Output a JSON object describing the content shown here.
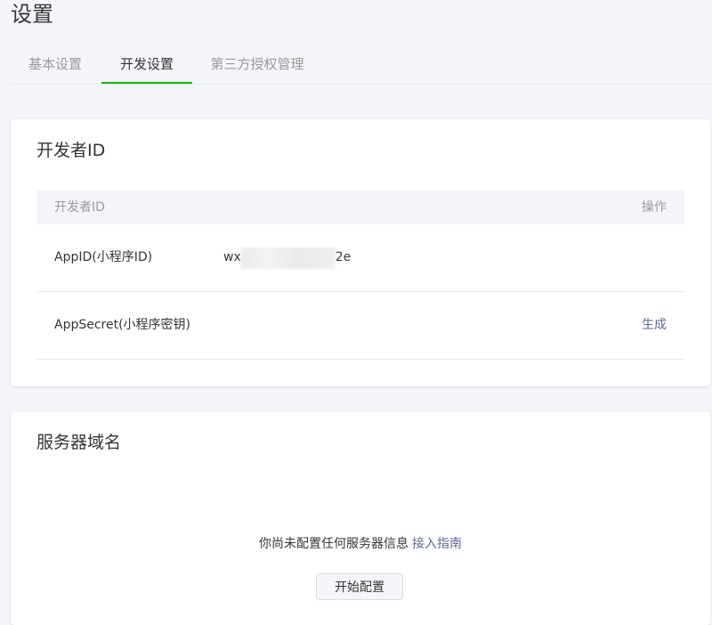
{
  "page": {
    "title": "设置"
  },
  "tabs": [
    {
      "label": "基本设置",
      "active": false
    },
    {
      "label": "开发设置",
      "active": true
    },
    {
      "label": "第三方授权管理",
      "active": false
    }
  ],
  "developer_id": {
    "title": "开发者ID",
    "table_header_left": "开发者ID",
    "table_header_right": "操作",
    "rows": [
      {
        "label": "AppID(小程序ID)",
        "value_prefix": "wx",
        "value_suffix": "2e",
        "action": ""
      },
      {
        "label": "AppSecret(小程序密钥)",
        "value_prefix": "",
        "value_suffix": "",
        "action": "生成"
      }
    ]
  },
  "server_domain": {
    "title": "服务器域名",
    "empty_text": "你尚未配置任何服务器信息",
    "guide_link": "接入指南",
    "start_button": "开始配置"
  },
  "colors": {
    "accent_green": "#1aad19",
    "link_blue": "#576b95",
    "page_bg": "#f4f5f9"
  }
}
